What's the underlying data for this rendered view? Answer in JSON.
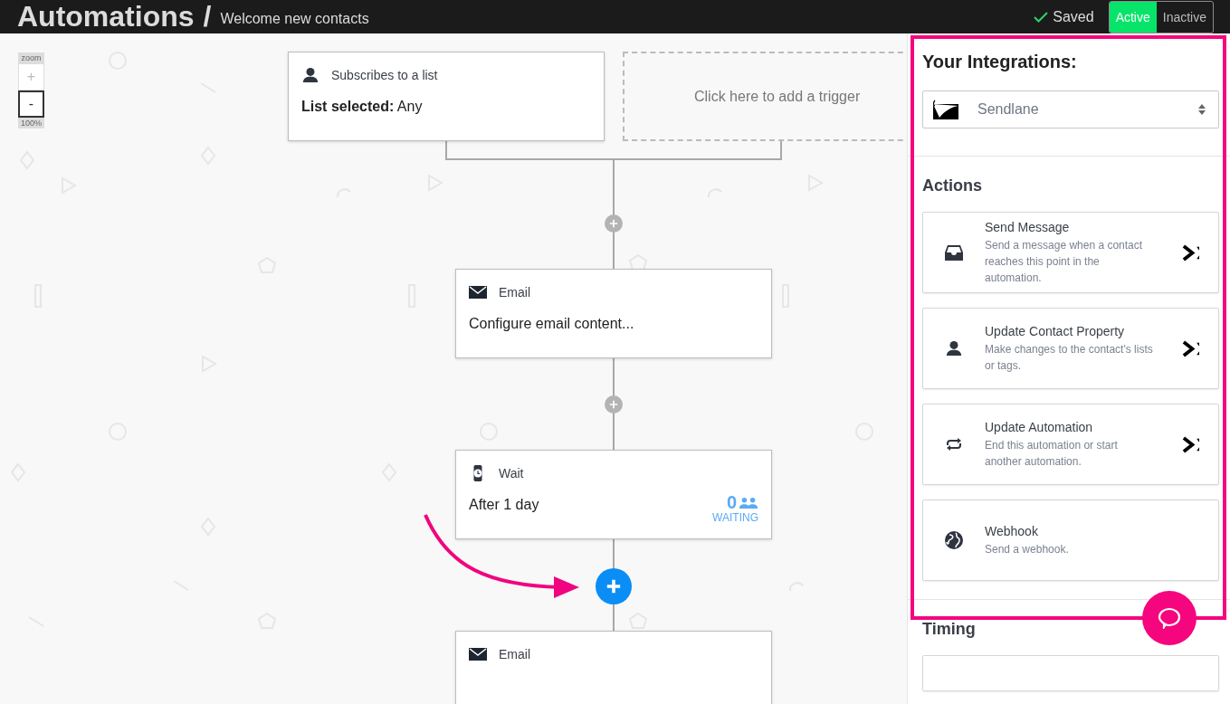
{
  "header": {
    "title": "Automations",
    "separator": "/",
    "subtitle": "Welcome new contacts",
    "saved": "Saved",
    "status_toggle": [
      {
        "label": "Active",
        "selected": true
      },
      {
        "label": "Inactive",
        "selected": false
      }
    ]
  },
  "zoom": {
    "label": "zoom",
    "zoom_in": "+",
    "zoom_out": "-",
    "level_text": "100%"
  },
  "flow": {
    "triggers": [
      {
        "kind": "trigger",
        "title": "Subscribes to a list",
        "body": "**List selected:** Any"
      },
      {
        "kind": "placeholder",
        "title": "Click here to add a trigger"
      }
    ],
    "steps": [
      {
        "kind": "email",
        "title": "Email",
        "body": "Configure email content..."
      },
      {
        "kind": "wait",
        "title": "Wait",
        "body": "After 1 day",
        "count": "0",
        "count_label": "WAITING"
      },
      {
        "kind": "email",
        "title": "Email"
      }
    ],
    "add_buttons": [
      {
        "highlighted": false
      },
      {
        "highlighted": false
      },
      {
        "highlighted": true
      }
    ]
  },
  "sidebar": {
    "integrations_title": "Your Integrations:",
    "integration": "Sendlane",
    "actions_title": "Actions",
    "actions": [
      {
        "kind": "message",
        "title": "Send Message",
        "description": "Send a message when a contact reaches this point in the automation.",
        "chevron": true
      },
      {
        "kind": "property",
        "title": "Update Contact Property",
        "description": "Make changes to the contact's lists or tags.",
        "chevron": true
      },
      {
        "kind": "automation",
        "title": "Update Automation",
        "description": "End this automation or start another automation.",
        "chevron": true
      },
      {
        "kind": "webhook",
        "title": "Webhook",
        "description": "Send a webhook.",
        "chevron": false
      }
    ],
    "timing_title": "Timing"
  }
}
